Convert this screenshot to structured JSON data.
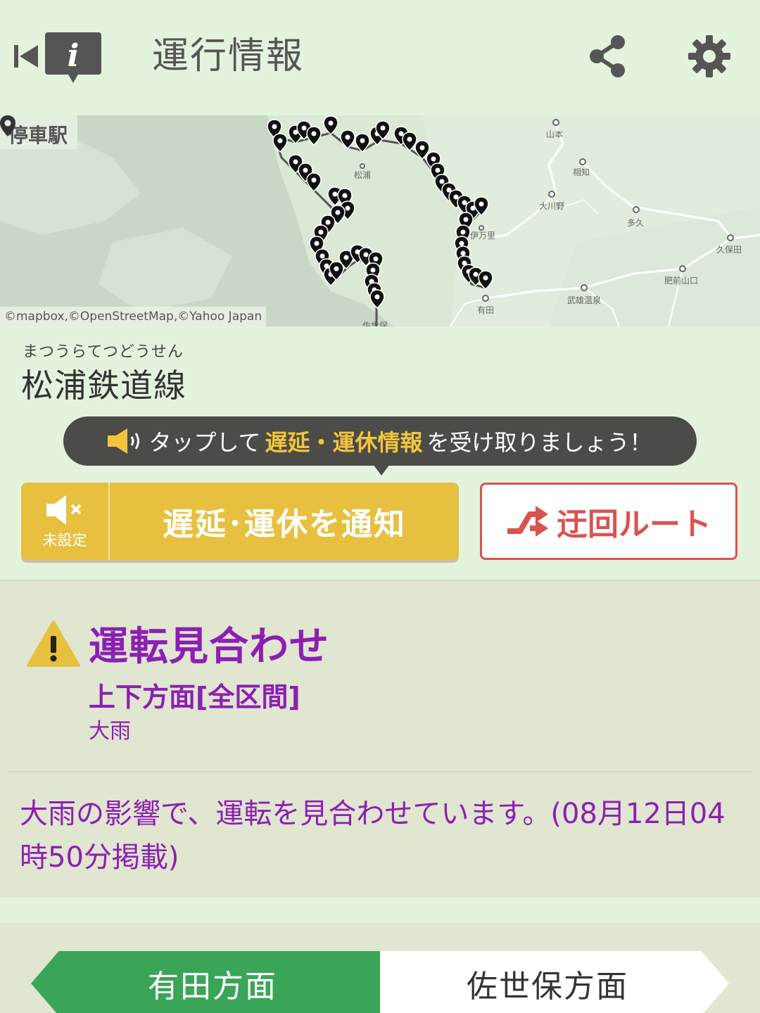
{
  "header": {
    "title": "運行情報"
  },
  "map": {
    "stop_label": "停車駅",
    "credit": "©mapbox,©OpenStreetMap,©Yahoo Japan",
    "stations": [
      "山本",
      "相知",
      "松浦",
      "大川野",
      "多久",
      "伊万里",
      "久保田",
      "肥前山口",
      "武雄温泉",
      "有田",
      "佐世保"
    ]
  },
  "line": {
    "ruby": "まつうらてつどうせん",
    "name": "松浦鉄道線"
  },
  "tooltip": {
    "prefix": "タップして",
    "highlight": "遅延・運休情報",
    "suffix": "を受け取りましょう！"
  },
  "notify": {
    "unset": "未設定",
    "label": "遅延･運休を通知"
  },
  "detour": {
    "label": "迂回ルート"
  },
  "status": {
    "title": "運転見合わせ",
    "section": "上下方面[全区間]",
    "cause": "大雨",
    "message": "大雨の影響で、運転を見合わせています。(08月12日04時50分掲載)"
  },
  "tabs": {
    "left": "有田方面",
    "right": "佐世保方面"
  },
  "colors": {
    "background": "#e4f3de",
    "status_text": "#8c1fb3",
    "notify_yellow": "#e8c040",
    "detour_red": "#d9534f",
    "tab_active": "#3aa557"
  }
}
